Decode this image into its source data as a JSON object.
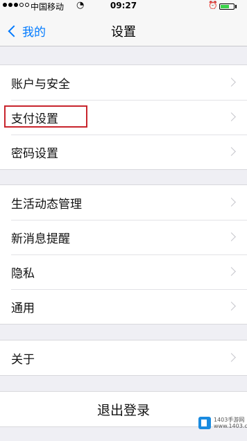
{
  "status_bar": {
    "carrier": "中国移动",
    "time": "09:27"
  },
  "nav": {
    "back_label": "我的",
    "title": "设置"
  },
  "groups": [
    {
      "items": [
        "账户与安全",
        "支付设置",
        "密码设置"
      ]
    },
    {
      "items": [
        "生活动态管理",
        "新消息提醒",
        "隐私",
        "通用"
      ]
    },
    {
      "items": [
        "关于"
      ]
    }
  ],
  "logout_label": "退出登录",
  "highlight_color": "#c8242c",
  "accent_color": "#007aff",
  "watermark": {
    "line1": "1403手游网",
    "line2": "www.1403.com"
  }
}
